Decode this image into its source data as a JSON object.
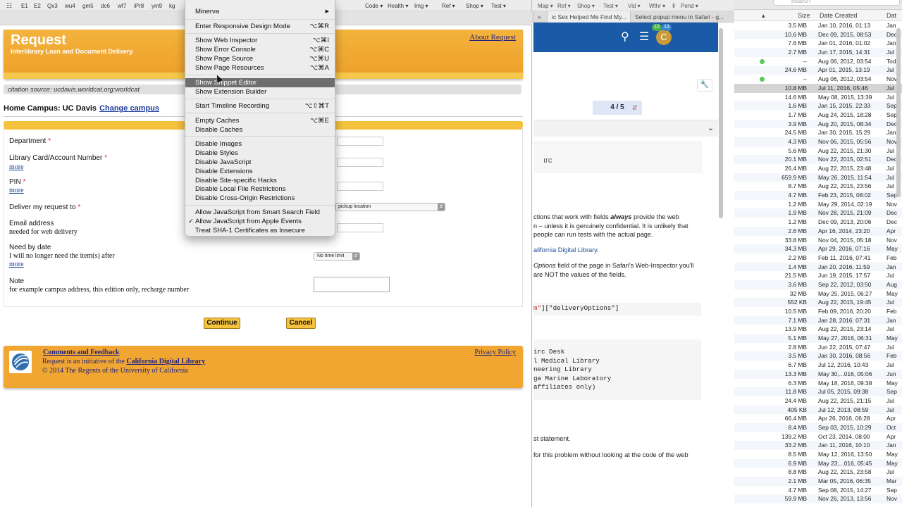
{
  "main_bookmarks": [
    "E1",
    "E2",
    "Qx3",
    "wu4",
    "gm5",
    "dc6",
    "wf7",
    "iPr8",
    "ym9",
    "kg"
  ],
  "mid_bookmarks": [
    "ing ▾",
    "Map ▾",
    "Ref ▾",
    "Shop ▾",
    "Test ▾",
    "Vid ▾",
    "Wthr ▾",
    "Ⅱ",
    "Pend ▾"
  ],
  "mid_bookmarks_left": [
    "Code ▾",
    "Health ▾",
    "Img ▾",
    "Ref ▾",
    "Shop ▾",
    "Test ▾"
  ],
  "mid_tabs": [
    "ic Sex Helped Me Find My...",
    "Select popup menu in Safari - g..."
  ],
  "page": {
    "title": "Request",
    "subtitle": "Interlibrary Loan and Document Delivery",
    "about_link": "About Request",
    "citation": "citation source: ucdavis.worldcat.org:worldcat",
    "home_campus": "Home Campus: UC Davis",
    "change_campus": "Change campus",
    "fields": {
      "department": "Department",
      "library_card": "Library Card/Account Number",
      "pin": "PIN",
      "deliver": "Deliver my request to",
      "email": "Email address",
      "email_sub": "needed for web delivery",
      "need_by": "Need by date",
      "need_by_sub": "I will no longer need the item(s) after",
      "note": "Note",
      "note_sub": "for example campus address, this edition only, recharge number",
      "more": "more",
      "required": "*"
    },
    "deliver_select": "pickup location",
    "time_select": "No time limit",
    "continue_btn": "Continue",
    "cancel_btn": "Cancel",
    "footer": {
      "comments": "Comments and Feedback",
      "initiative_pre": "Request is an initiative of the",
      "initiative_link": "California Digital Library",
      "copyright": "© 2014 The Regents of the University of California",
      "privacy": "Privacy Policy"
    }
  },
  "menu": {
    "items": [
      {
        "label": "Minerva",
        "shortcut": "",
        "submenu": true
      },
      {
        "label": "Enter Responsive Design Mode",
        "shortcut": "⌥⌘R"
      },
      {
        "label": "Show Web Inspector",
        "shortcut": "⌥⌘I"
      },
      {
        "label": "Show Error Console",
        "shortcut": "⌥⌘C"
      },
      {
        "label": "Show Page Source",
        "shortcut": "⌥⌘U"
      },
      {
        "label": "Show Page Resources",
        "shortcut": "⌥⌘A"
      },
      {
        "label": "Show Snippet Editor",
        "shortcut": ""
      },
      {
        "label": "Show Extension Builder",
        "shortcut": ""
      },
      {
        "label": "Start Timeline Recording",
        "shortcut": "⌥⇧⌘T"
      },
      {
        "label": "Empty Caches",
        "shortcut": "⌥⌘E"
      },
      {
        "label": "Disable Caches",
        "shortcut": ""
      },
      {
        "label": "Disable Images",
        "shortcut": ""
      },
      {
        "label": "Disable Styles",
        "shortcut": ""
      },
      {
        "label": "Disable JavaScript",
        "shortcut": ""
      },
      {
        "label": "Disable Extensions",
        "shortcut": ""
      },
      {
        "label": "Disable Site-specific Hacks",
        "shortcut": ""
      },
      {
        "label": "Disable Local File Restrictions",
        "shortcut": ""
      },
      {
        "label": "Disable Cross-Origin Restrictions",
        "shortcut": ""
      },
      {
        "label": "Allow JavaScript from Smart Search Field",
        "shortcut": ""
      },
      {
        "label": "Allow JavaScript from Apple Events",
        "shortcut": "",
        "checked": true
      },
      {
        "label": "Treat SHA-1 Certificates as Insecure",
        "shortcut": ""
      }
    ],
    "highlighted": "Show Snippet Editor",
    "checkmark": "✓"
  },
  "mid": {
    "pager": "4 / 5",
    "badge_green": "12",
    "badge_blue": "13",
    "avatar": "C",
    "p1_a": "ctions that work with fields ",
    "p1_em": "always",
    "p1_b": " provide the web",
    "p1_c": "n – unless it is genuinely confidential. It is unlikely that",
    "p1_d": "people can run tests with the actual page.",
    "p2_link": "alifornia Digital Library",
    "p3_em": "Options",
    "p3_a": " field of the page in Safari's Web-Inspector you'll",
    "p3_b": "are NOT the values of the fields.",
    "code1_str": "m\"",
    "code1_rest": "][\"deliveryOptions\"]",
    "code2": [
      "irc Desk",
      "l Medical Library",
      "neering Library",
      "ga Marine Laboratory",
      "affiliates only)"
    ],
    "p4": "st statement.",
    "p5": " for this problem without looking at the code of the web"
  },
  "finder": {
    "search": "Search",
    "col_size": "Size",
    "col_date": "Date Created",
    "col_kind": "Dat",
    "rows": [
      [
        "3.5 MB",
        "Jan 10, 2016, 01:13",
        "Jan"
      ],
      [
        "10.6 MB",
        "Dec 09, 2015, 08:53",
        "Dec"
      ],
      [
        "7.6 MB",
        "Jan 01, 2016, 01:02",
        "Jan"
      ],
      [
        "2.7 MB",
        "Jun 17, 2015, 14:31",
        "Jul"
      ],
      [
        "--",
        "Aug 06, 2012, 03:54",
        "Tod"
      ],
      [
        "24.6 MB",
        "Apr 01, 2015, 13:19",
        "Jul"
      ],
      [
        "--",
        "Aug 06, 2012, 03:54",
        "Nov"
      ],
      [
        "10.8 MB",
        "Jul 11, 2016, 05:46",
        "Jul"
      ],
      [
        "14.6 MB",
        "May 08, 2015, 13:39",
        "Jul"
      ],
      [
        "1.6 MB",
        "Jan 15, 2015, 22:33",
        "Sep"
      ],
      [
        "1.7 MB",
        "Aug 24, 2015, 18:28",
        "Sep"
      ],
      [
        "3.9 MB",
        "Aug 20, 2015, 08:34",
        "Dec"
      ],
      [
        "24.5 MB",
        "Jan 30, 2015, 15:29",
        "Jan"
      ],
      [
        "4.3 MB",
        "Nov 06, 2015, 05:56",
        "Nov"
      ],
      [
        "5.6 MB",
        "Aug 22, 2015, 21:30",
        "Jul"
      ],
      [
        "20.1 MB",
        "Nov 22, 2015, 02:51",
        "Dec"
      ],
      [
        "26.4 MB",
        "Aug 22, 2015, 23:48",
        "Jul"
      ],
      [
        "659.9 MB",
        "May 26, 2015, 11:54",
        "Jul"
      ],
      [
        "8.7 MB",
        "Aug 22, 2015, 23:56",
        "Jul"
      ],
      [
        "4.7 MB",
        "Feb 23, 2015, 08:02",
        "Sep"
      ],
      [
        "1.2 MB",
        "May 29, 2014, 02:19",
        "Nov"
      ],
      [
        "1.9 MB",
        "Nov 28, 2015, 21:09",
        "Dec"
      ],
      [
        "1.2 MB",
        "Dec 09, 2013, 20:06",
        "Dec"
      ],
      [
        "2.6 MB",
        "Apr 16, 2014, 23:20",
        "Apr"
      ],
      [
        "33.8 MB",
        "Nov 04, 2015, 05:18",
        "Nov"
      ],
      [
        "34.3 MB",
        "Apr 29, 2016, 07:16",
        "May"
      ],
      [
        "2.2 MB",
        "Feb 11, 2016, 07:41",
        "Feb"
      ],
      [
        "1.4 MB",
        "Jan 20, 2016, 11:59",
        "Jan"
      ],
      [
        "21.5 MB",
        "Jun 19, 2015, 17:57",
        "Jul"
      ],
      [
        "3.6 MB",
        "Sep 22, 2012, 03:50",
        "Aug"
      ],
      [
        "32 MB",
        "May 25, 2015, 06:27",
        "May"
      ],
      [
        "552 KB",
        "Aug 22, 2015, 19:45",
        "Jul"
      ],
      [
        "10.5 MB",
        "Feb 09, 2016, 20:20",
        "Feb"
      ],
      [
        "7.1 MB",
        "Jan 28, 2016, 07:31",
        "Jan"
      ],
      [
        "13.9 MB",
        "Aug 22, 2015, 23:14",
        "Jul"
      ],
      [
        "5.1 MB",
        "May 27, 2016, 06:31",
        "May"
      ],
      [
        "2.8 MB",
        "Jun 22, 2015, 07:47",
        "Jul"
      ],
      [
        "3.5 MB",
        "Jan 30, 2016, 08:56",
        "Feb"
      ],
      [
        "6.7 MB",
        "Jul 12, 2016, 10:43",
        "Jul"
      ],
      [
        "13.3 MB",
        "May 30,...016, 05:06",
        "Jun"
      ],
      [
        "6.3 MB",
        "May 18, 2016, 09:38",
        "May"
      ],
      [
        "11.8 MB",
        "Jul 05, 2015, 09:38",
        "Sep"
      ],
      [
        "24.4 MB",
        "Aug 22, 2015, 21:15",
        "Jul"
      ],
      [
        "405 KB",
        "Jul 12, 2013, 08:59",
        "Jul"
      ],
      [
        "66.4 MB",
        "Apr 26, 2016, 06:28",
        "Apr"
      ],
      [
        "8.4 MB",
        "Sep 03, 2015, 10:29",
        "Oct"
      ],
      [
        "139.2 MB",
        "Oct 23, 2014, 08:00",
        "Apr"
      ],
      [
        "33.2 MB",
        "Jan 11, 2016, 10:10",
        "Jan"
      ],
      [
        "8.5 MB",
        "May 12, 2016, 13:50",
        "May"
      ],
      [
        "6.9 MB",
        "May 23,...016, 05:45",
        "May"
      ],
      [
        "8.8 MB",
        "Aug 22, 2015, 23:58",
        "Jul"
      ],
      [
        "2.1 MB",
        "Mar 05, 2016, 06:35",
        "Mar"
      ],
      [
        "4.7 MB",
        "Sep 08, 2015, 14:27",
        "Sep"
      ],
      [
        "59.9 MB",
        "Nov 26, 2013, 13:56",
        "Nov"
      ]
    ]
  }
}
